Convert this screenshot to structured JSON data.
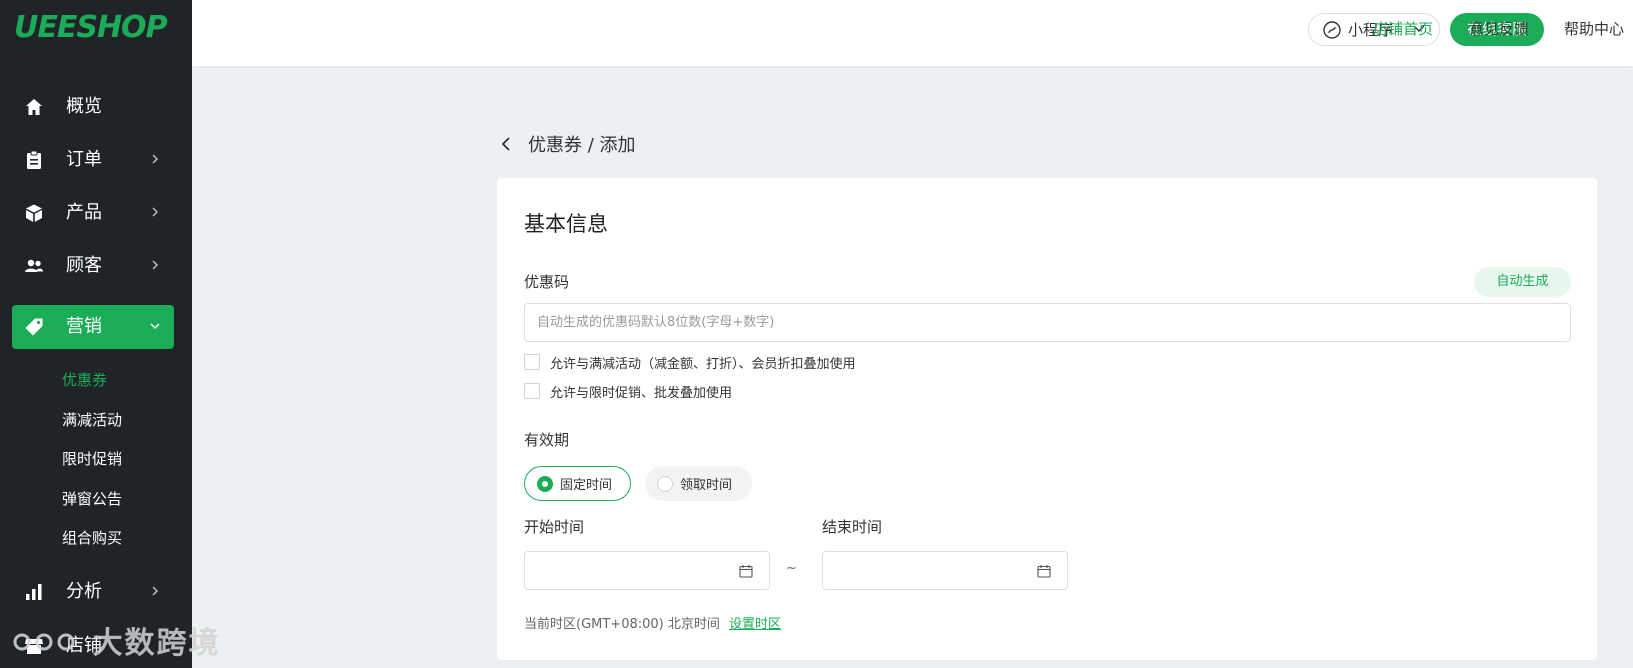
{
  "app": {
    "logo": "UEESHOP"
  },
  "sidebar": {
    "items": [
      {
        "label": "概览",
        "icon": "home-icon"
      },
      {
        "label": "订单",
        "icon": "clipboard-icon"
      },
      {
        "label": "产品",
        "icon": "box-icon"
      },
      {
        "label": "顾客",
        "icon": "users-icon"
      },
      {
        "label": "营销",
        "icon": "tag-icon"
      },
      {
        "label": "分析",
        "icon": "bar-chart-icon"
      },
      {
        "label": "店铺",
        "icon": "store-icon"
      }
    ],
    "sub_items": [
      {
        "label": "优惠券"
      },
      {
        "label": "满减活动"
      },
      {
        "label": "限时促销"
      },
      {
        "label": "弹窗公告"
      },
      {
        "label": "组合购买"
      }
    ],
    "watermark": "大数跨境"
  },
  "header": {
    "mini_program": "小程序",
    "customer_service": "在线客服",
    "links": [
      "店铺首页",
      "意见反馈",
      "帮助中心"
    ]
  },
  "breadcrumb": "优惠券 / 添加",
  "form": {
    "title": "基本信息",
    "code_label": "优惠码",
    "auto_generate": "自动生成",
    "code_placeholder": "自动生成的优惠码默认8位数(字母+数字)",
    "checkbox1": "允许与满减活动（减金额、打折）、会员折扣叠加使用",
    "checkbox2": "允许与限时促销、批发叠加使用",
    "validity_label": "有效期",
    "radio_fixed": "固定时间",
    "radio_claim": "领取时间",
    "start_label": "开始时间",
    "end_label": "结束时间",
    "tilde": "~",
    "timezone_text": "当前时区(GMT+08:00) 北京时间",
    "timezone_link": "设置时区"
  },
  "colors": {
    "brand": "#1aac57",
    "sidebar_bg": "#202428",
    "page_bg": "#edf0f2"
  }
}
